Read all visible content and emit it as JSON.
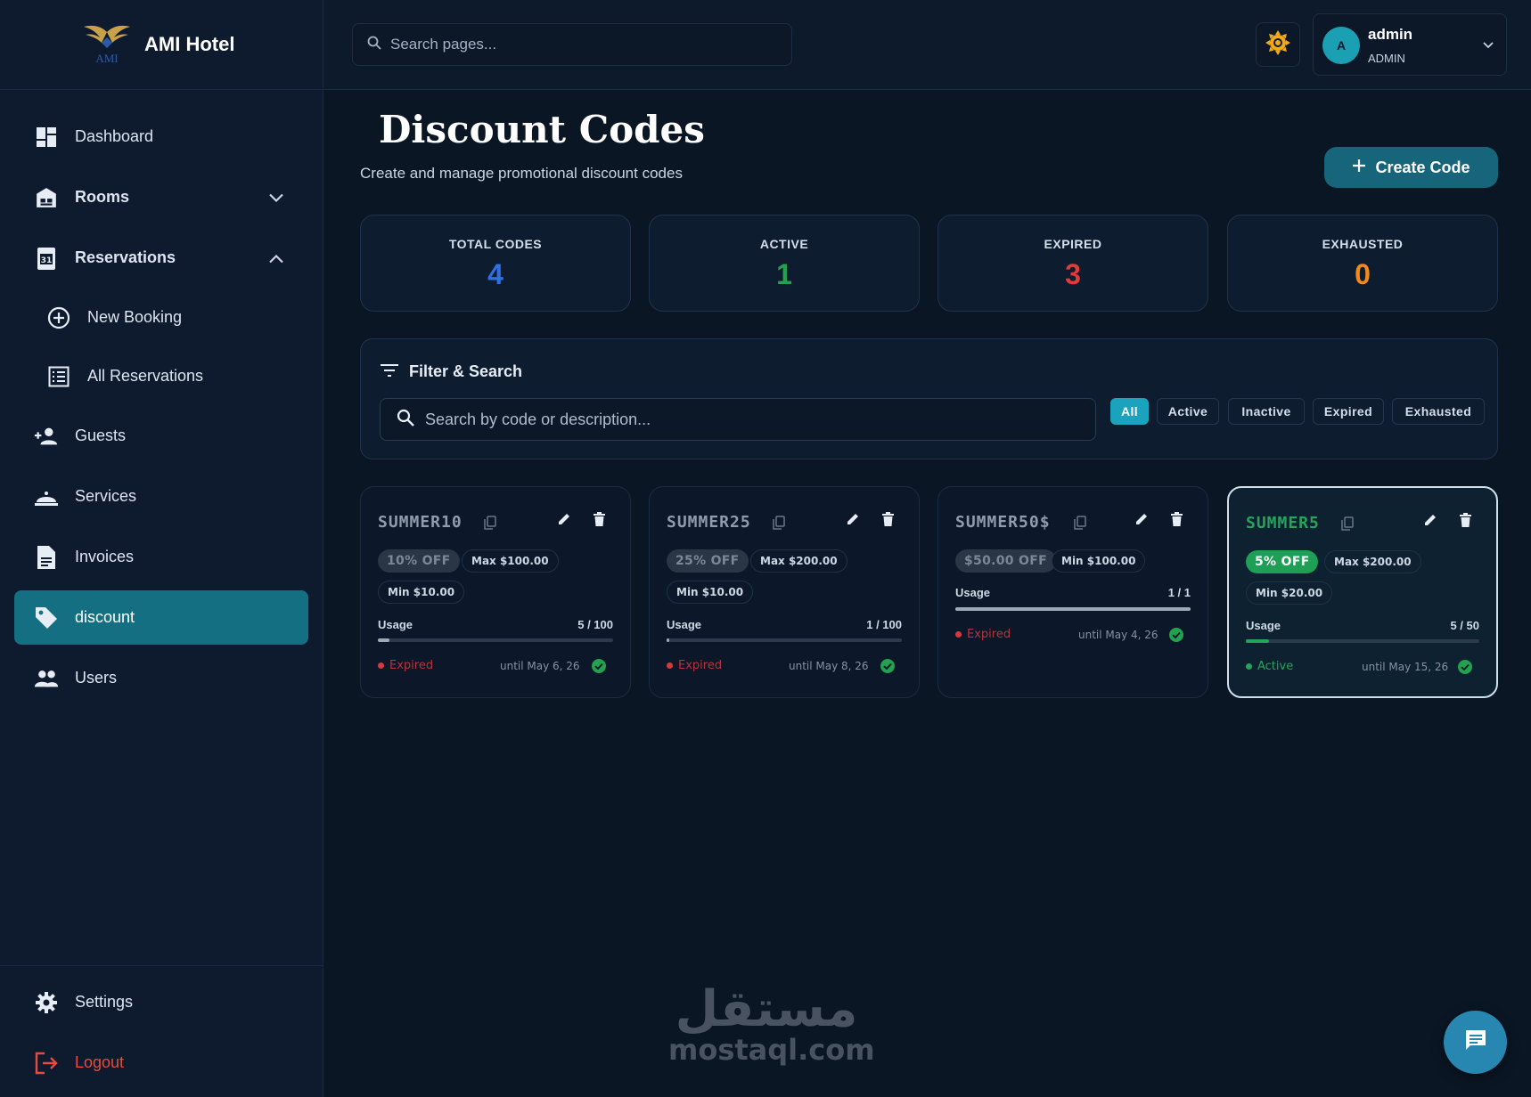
{
  "brand": {
    "name": "AMI Hotel",
    "logo_text": "AMI"
  },
  "sidebar": {
    "items": [
      {
        "label": "Dashboard",
        "icon": "dashboard-icon"
      },
      {
        "label": "Rooms",
        "icon": "building-icon"
      },
      {
        "label": "Reservations",
        "icon": "calendar-icon"
      },
      {
        "label": "New Booking",
        "icon": "plus-circle-icon"
      },
      {
        "label": "All Reservations",
        "icon": "list-icon"
      },
      {
        "label": "Guests",
        "icon": "person-add-icon"
      },
      {
        "label": "Services",
        "icon": "cloche-icon"
      },
      {
        "label": "Invoices",
        "icon": "document-icon"
      },
      {
        "label": "discount",
        "icon": "tag-icon"
      },
      {
        "label": "Users",
        "icon": "users-icon"
      }
    ],
    "settings": "Settings",
    "logout": "Logout"
  },
  "topbar": {
    "search_placeholder": "Search pages...",
    "user": {
      "initial": "A",
      "name": "admin",
      "role": "ADMIN"
    }
  },
  "page": {
    "title": "Discount Codes",
    "subtitle": "Create and manage promotional discount codes",
    "create_label": "Create Code"
  },
  "stats": [
    {
      "label": "TOTAL CODES",
      "value": "4",
      "color": "#2f6fe0"
    },
    {
      "label": "ACTIVE",
      "value": "1",
      "color": "#23a14f"
    },
    {
      "label": "EXPIRED",
      "value": "3",
      "color": "#df3b3b"
    },
    {
      "label": "EXHAUSTED",
      "value": "0",
      "color": "#f08a1c"
    }
  ],
  "filter": {
    "title": "Filter & Search",
    "search_placeholder": "Search by code or description...",
    "chips": [
      "All",
      "Active",
      "Inactive",
      "Expired",
      "Exhausted"
    ],
    "selected": "All"
  },
  "codes": [
    {
      "code": "SUMMER10",
      "off": "10% OFF",
      "max": "Max $100.00",
      "min": "Min $10.00",
      "usage_label": "Usage",
      "usage": "5 / 100",
      "usage_fraction": 0.05,
      "status": "Expired",
      "until": "until May 6, 26"
    },
    {
      "code": "SUMMER25",
      "off": "25% OFF",
      "max": "Max $200.00",
      "min": "Min $10.00",
      "usage_label": "Usage",
      "usage": "1 / 100",
      "usage_fraction": 0.01,
      "status": "Expired",
      "until": "until May 8, 26"
    },
    {
      "code": "SUMMER50$",
      "off": "$50.00 OFF",
      "min": "Min $100.00",
      "usage_label": "Usage",
      "usage": "1 / 1",
      "usage_fraction": 1.0,
      "status": "Expired",
      "until": "until May 4, 26"
    },
    {
      "code": "SUMMER5",
      "off": "5% OFF",
      "max": "Max $200.00",
      "min": "Min $20.00",
      "usage_label": "Usage",
      "usage": "5 / 50",
      "usage_fraction": 0.1,
      "status": "Active",
      "until": "until May 15, 26"
    }
  ],
  "watermark": {
    "arabic": "مستقل",
    "english": "mostaql.com"
  },
  "colors": {
    "accent": "#146f82",
    "active_green": "#27a35b",
    "expired_red": "#d23a40"
  }
}
